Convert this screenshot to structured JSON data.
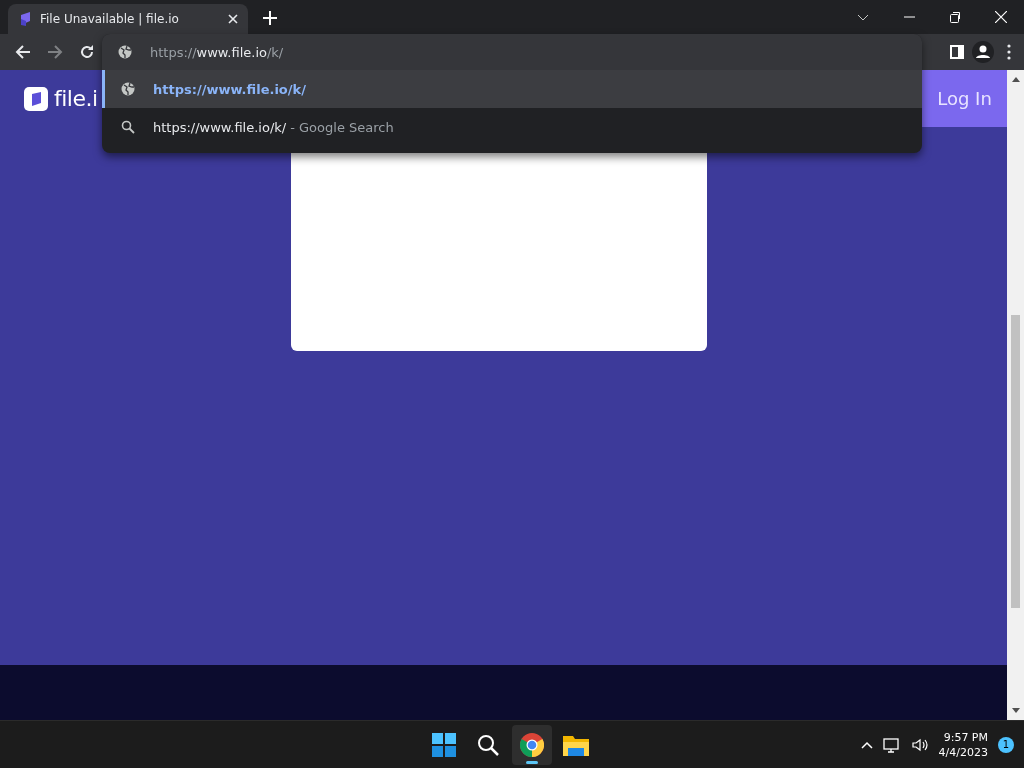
{
  "tabs": [
    {
      "title": "File Unavailable | file.io",
      "selected": true
    }
  ],
  "address_bar": {
    "scheme": "https://",
    "host": "www.file.io",
    "path": "/k/"
  },
  "suggestions": [
    {
      "kind": "url",
      "text": "https://www.file.io/k/",
      "selected": true
    },
    {
      "kind": "search",
      "text": "https://www.file.io/k/",
      "hint": "- Google Search",
      "selected": false
    }
  ],
  "page": {
    "logo": "file.i",
    "login": "Log In"
  },
  "taskbar": {
    "apps": [
      {
        "kind": "start",
        "selected": false
      },
      {
        "kind": "search",
        "selected": false
      },
      {
        "kind": "chrome",
        "selected": true
      },
      {
        "kind": "explorer",
        "selected": false
      }
    ],
    "time": "9:57 PM",
    "date": "4/4/2023",
    "notifications": "1"
  }
}
